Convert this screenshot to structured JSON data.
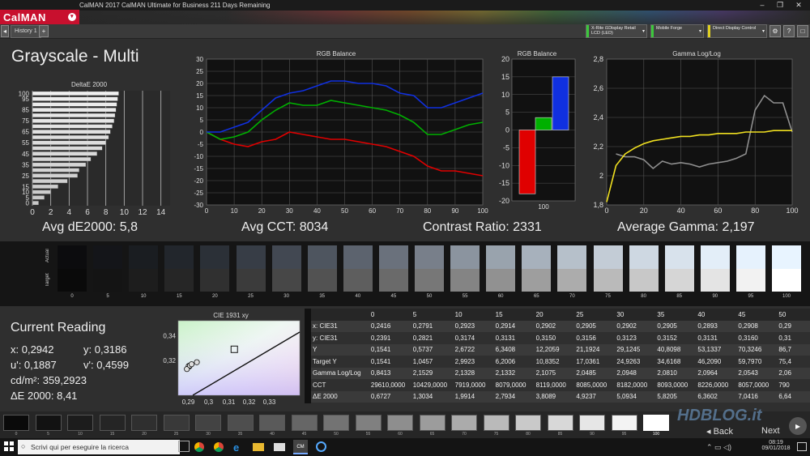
{
  "window": {
    "title": "CalMAN 2017 CalMAN Ultimate for Business 211 Days Remaining",
    "minimize": "–",
    "maximize": "❐",
    "close": "✕"
  },
  "app": {
    "logo": "CalMAN",
    "logo_menu": "▾"
  },
  "toolbar": {
    "tab": "History 1",
    "add_tab": "+",
    "nav_left": "◂",
    "devices": [
      {
        "label": "X-Rite i1Display Retail LCD (LED)",
        "color": "#3cc83c"
      },
      {
        "label": "Mobile Forge",
        "color": "#3cc83c"
      },
      {
        "label": "Direct Display Control",
        "color": "#e0d020"
      }
    ],
    "buttons": [
      "⚙",
      "?",
      "□"
    ]
  },
  "page": {
    "title": "Grayscale - Multi"
  },
  "charts": {
    "deltae": {
      "title": "DeltaE 2000",
      "metric": "Avg dE2000: 5,8"
    },
    "rgb": {
      "title": "RGB Balance",
      "metric": "Avg CCT: 8034"
    },
    "rgbbar": {
      "title": "RGB Balance",
      "metric": "Contrast Ratio: 2331"
    },
    "gamma": {
      "title": "Gamma Log/Log",
      "metric": "Average Gamma: 2,197"
    },
    "cie": {
      "title": "CIE 1931 xy"
    }
  },
  "chart_data": [
    {
      "type": "bar",
      "title": "DeltaE 2000",
      "orientation": "horizontal",
      "categories": [
        "0",
        "5",
        "10",
        "15",
        "20",
        "25",
        "30",
        "35",
        "40",
        "45",
        "50",
        "55",
        "60",
        "65",
        "70",
        "75",
        "80",
        "85",
        "90",
        "95",
        "100"
      ],
      "values": [
        0.67,
        1.3,
        1.99,
        2.79,
        3.81,
        4.92,
        5.09,
        5.82,
        6.36,
        7.04,
        7.6,
        8.0,
        8.3,
        8.5,
        8.7,
        8.9,
        9.0,
        9.1,
        9.2,
        9.3,
        9.4
      ],
      "ytick_labels": [
        "0",
        "5",
        "10",
        "15",
        "25",
        "35",
        "45",
        "55",
        "65",
        "75",
        "85",
        "95",
        "100"
      ],
      "xtick_labels": [
        "0",
        "2",
        "4",
        "6",
        "8",
        "10",
        "12",
        "14"
      ],
      "xlim": [
        0,
        15
      ]
    },
    {
      "type": "line",
      "title": "RGB Balance",
      "x": [
        0,
        5,
        10,
        15,
        20,
        25,
        30,
        35,
        40,
        45,
        50,
        55,
        60,
        65,
        70,
        75,
        80,
        85,
        90,
        95,
        100
      ],
      "series": [
        {
          "color": "#e00000",
          "values": [
            0,
            -3,
            -5,
            -6,
            -4,
            -3,
            0,
            -1,
            -2,
            -3,
            -3,
            -4,
            -5,
            -6,
            -8,
            -10,
            -14,
            -16,
            -16,
            -17,
            -18
          ]
        },
        {
          "color": "#00b000",
          "values": [
            0,
            -3,
            -2,
            0,
            5,
            9,
            12,
            11,
            11,
            13,
            12,
            11,
            10,
            9,
            7,
            4,
            -1,
            -1,
            1,
            3,
            4
          ]
        },
        {
          "color": "#1030e0",
          "values": [
            0,
            0,
            2,
            4,
            9,
            14,
            16,
            17,
            19,
            21,
            21,
            20,
            20,
            19,
            16,
            15,
            10,
            10,
            12,
            14,
            16
          ]
        }
      ],
      "xlim": [
        0,
        100
      ],
      "ylim": [
        -30,
        30
      ],
      "xtick_labels": [
        "0",
        "10",
        "20",
        "30",
        "40",
        "50",
        "60",
        "70",
        "80",
        "90",
        "100"
      ],
      "ytick_labels": [
        "30",
        "25",
        "20",
        "15",
        "10",
        "5",
        "0",
        "-5",
        "-10",
        "-15",
        "-20",
        "-25",
        "-30"
      ]
    },
    {
      "type": "bar",
      "title": "RGB Balance",
      "categories": [
        "R",
        "G",
        "B"
      ],
      "values": [
        -18,
        3.5,
        15
      ],
      "colors": [
        "#e00000",
        "#00b000",
        "#1030e0"
      ],
      "ylim": [
        -20,
        20
      ],
      "xtick_labels": [
        "100"
      ],
      "ytick_labels": [
        "20",
        "15",
        "10",
        "5",
        "0",
        "-5",
        "-10",
        "-15",
        "-20"
      ]
    },
    {
      "type": "line",
      "title": "Gamma Log/Log",
      "x": [
        0,
        5,
        10,
        15,
        20,
        25,
        30,
        35,
        40,
        45,
        50,
        55,
        60,
        65,
        70,
        75,
        80,
        85,
        90,
        95,
        100
      ],
      "series": [
        {
          "color": "#8f8f8f",
          "values": [
            null,
            2.15,
            2.13,
            2.13,
            2.11,
            2.05,
            2.1,
            2.08,
            2.09,
            2.08,
            2.06,
            2.08,
            2.09,
            2.1,
            2.12,
            2.15,
            2.45,
            2.55,
            2.5,
            2.5,
            2.3
          ]
        },
        {
          "color": "#f0e020",
          "values": [
            1.82,
            2.07,
            2.15,
            2.19,
            2.22,
            2.24,
            2.25,
            2.26,
            2.27,
            2.27,
            2.28,
            2.28,
            2.29,
            2.29,
            2.29,
            2.3,
            2.3,
            2.3,
            2.31,
            2.31,
            2.31
          ]
        }
      ],
      "xlim": [
        0,
        100
      ],
      "ylim": [
        1.8,
        2.8
      ],
      "xtick_labels": [
        "0",
        "20",
        "40",
        "60",
        "80",
        "100"
      ],
      "ytick_labels": [
        "2,8",
        "2,6",
        "2,4",
        "2,2",
        "2",
        "1,8"
      ]
    },
    {
      "type": "scatter",
      "title": "CIE 1931 xy",
      "x": [
        0.2942,
        0.2905,
        0.2902,
        0.2893,
        0.2908,
        0.2916
      ],
      "y": [
        0.3186,
        0.3152,
        0.3156,
        0.3131,
        0.316,
        0.317
      ],
      "target": [
        0.3127,
        0.329
      ],
      "xlim": [
        0.285,
        0.345
      ],
      "ylim": [
        0.292,
        0.352
      ],
      "xtick_labels": [
        "0,29",
        "0,3",
        "0,31",
        "0,32",
        "0,33"
      ],
      "ytick_labels": [
        "0,34",
        "0,32"
      ]
    }
  ],
  "swatches": {
    "row_labels": [
      "Actual",
      "Target"
    ],
    "levels": [
      "0",
      "5",
      "10",
      "15",
      "20",
      "25",
      "30",
      "35",
      "40",
      "45",
      "50",
      "55",
      "60",
      "65",
      "70",
      "75",
      "80",
      "85",
      "90",
      "95",
      "100"
    ],
    "actual": [
      "#0c0c0e",
      "#141519",
      "#1a1d21",
      "#22262c",
      "#2b3037",
      "#373d46",
      "#424852",
      "#4e555f",
      "#5c636e",
      "#6a717c",
      "#787f8a",
      "#8b949f",
      "#99a3ad",
      "#a7b1bc",
      "#b6c0ca",
      "#c3ccd6",
      "#ced8e2",
      "#d8e2ec",
      "#e3eef8",
      "#e6f2fd",
      "#e8f4ff"
    ],
    "target": [
      "#0a0a0a",
      "#141414",
      "#1d1d1d",
      "#262626",
      "#303030",
      "#3b3b3b",
      "#474747",
      "#525252",
      "#5e5e5e",
      "#6a6a6a",
      "#777777",
      "#848484",
      "#919191",
      "#9e9e9e",
      "#acacac",
      "#bababa",
      "#c8c8c8",
      "#d6d6d6",
      "#e4e4e4",
      "#f2f2f2",
      "#ffffff"
    ]
  },
  "current_reading": {
    "title": "Current Reading",
    "x": "x: 0,2942",
    "y": "y: 0,3186",
    "u": "u': 0,1887",
    "v": "v': 0,4599",
    "cd": "cd/m²: 359,2923",
    "de": "ΔE 2000: 8,41"
  },
  "table": {
    "columns": [
      "0",
      "5",
      "10",
      "15",
      "20",
      "25",
      "30",
      "35",
      "40",
      "45",
      "50"
    ],
    "rows": [
      {
        "label": "x: CIE31",
        "values": [
          "0,2416",
          "0,2791",
          "0,2923",
          "0,2914",
          "0,2902",
          "0,2905",
          "0,2902",
          "0,2905",
          "0,2893",
          "0,2908",
          "0,29"
        ]
      },
      {
        "label": "y: CIE31",
        "values": [
          "0,2391",
          "0,2821",
          "0,3174",
          "0,3131",
          "0,3150",
          "0,3156",
          "0,3123",
          "0,3152",
          "0,3131",
          "0,3160",
          "0,31"
        ]
      },
      {
        "label": "Y",
        "values": [
          "0,1541",
          "0,5737",
          "2,6722",
          "6,3408",
          "12,2059",
          "21,1924",
          "29,1245",
          "40,8098",
          "53,1337",
          "70,3246",
          "86,7"
        ]
      },
      {
        "label": "Target Y",
        "values": [
          "0,1541",
          "1,0457",
          "2,9923",
          "6,2006",
          "10,8352",
          "17,0361",
          "24,9263",
          "34,6168",
          "46,2090",
          "59,7970",
          "75,4"
        ]
      },
      {
        "label": "Gamma Log/Log",
        "values": [
          "0,8413",
          "2,1529",
          "2,1328",
          "2,1332",
          "2,1075",
          "2,0485",
          "2,0948",
          "2,0810",
          "2,0964",
          "2,0543",
          "2,06"
        ]
      },
      {
        "label": "CCT",
        "values": [
          "29610,0000",
          "10429,0000",
          "7919,0000",
          "8079,0000",
          "8119,0000",
          "8085,0000",
          "8182,0000",
          "8093,0000",
          "8226,0000",
          "8057,0000",
          "790"
        ]
      },
      {
        "label": "ΔE 2000",
        "values": [
          "0,6727",
          "1,3034",
          "1,9914",
          "2,7934",
          "3,8089",
          "4,9237",
          "5,0934",
          "5,8205",
          "6,3602",
          "7,0416",
          "6,64"
        ]
      }
    ]
  },
  "bottom_swatches": {
    "levels": [
      "0",
      "5",
      "10",
      "15",
      "20",
      "25",
      "30",
      "35",
      "40",
      "45",
      "50",
      "55",
      "60",
      "65",
      "70",
      "75",
      "80",
      "85",
      "90",
      "95",
      "100"
    ],
    "colors": [
      "#0a0a0a",
      "#121212",
      "#1c1c1c",
      "#252525",
      "#2f2f2f",
      "#393939",
      "#434343",
      "#4e4e4e",
      "#5a5a5a",
      "#666666",
      "#737373",
      "#808080",
      "#8e8e8e",
      "#9c9c9c",
      "#ababab",
      "#bababa",
      "#c9c9c9",
      "#d8d8d8",
      "#e6e6e6",
      "#f3f3f3",
      "#ffffff"
    ],
    "selected": "100"
  },
  "nav": {
    "back": "Back",
    "next": "Next",
    "watermark": "HDBLOG.it"
  },
  "taskbar": {
    "search_placeholder": "Scrivi qui per eseguire la ricerca",
    "time": "08:19",
    "date": "09/01/2018"
  }
}
